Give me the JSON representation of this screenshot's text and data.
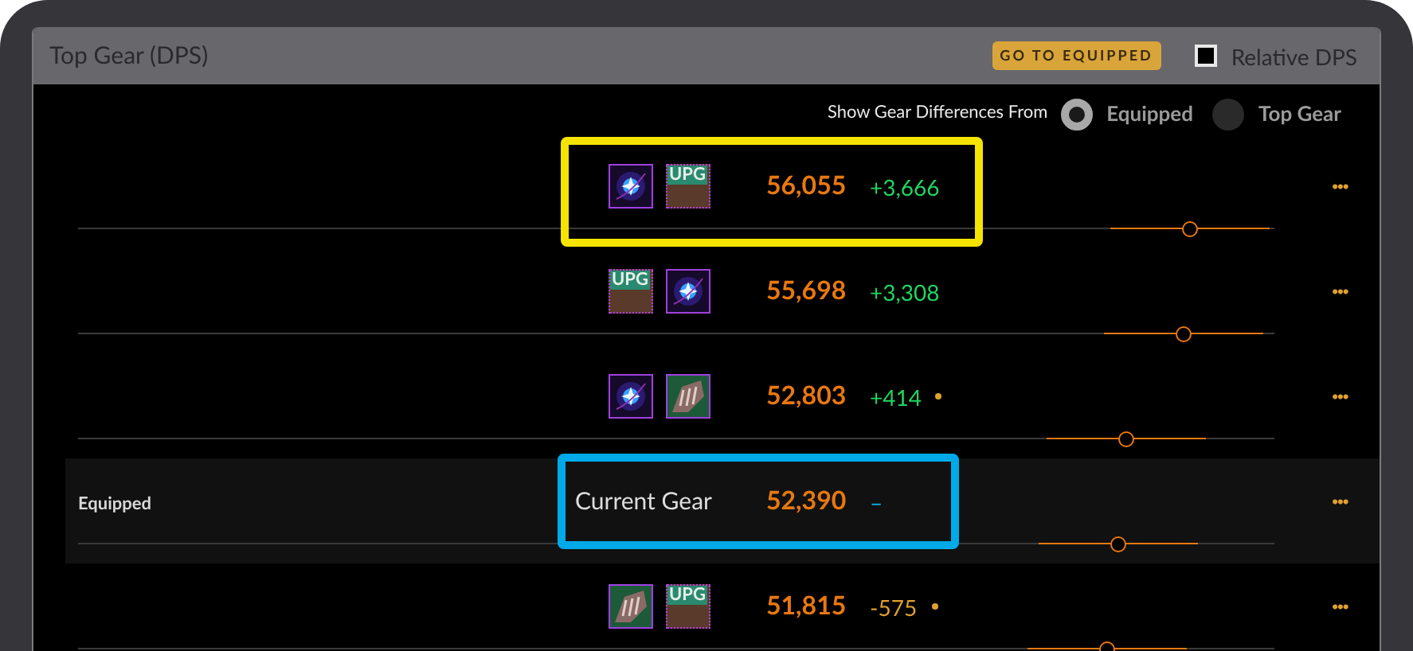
{
  "header": {
    "title": "Top Gear (DPS)",
    "button": "GO TO EQUIPPED",
    "relative": {
      "label": "Relative DPS",
      "checked": false
    }
  },
  "compare": {
    "label": "Show Gear Differences From",
    "options": [
      {
        "label": "Equipped",
        "selected": true
      },
      {
        "label": "Top Gear",
        "selected": false
      }
    ]
  },
  "rows": [
    {
      "kind": "set",
      "items": [
        {
          "kind": "gem"
        },
        {
          "kind": "upg",
          "badge": "UPG"
        }
      ],
      "score": "56,055",
      "diff": {
        "text": "+3,666",
        "color": "#1ed760"
      },
      "dot": false,
      "level": 0.93,
      "menu": "···",
      "highlight": {
        "color": "#f5e400"
      }
    },
    {
      "kind": "set",
      "items": [
        {
          "kind": "upg",
          "badge": "UPG"
        },
        {
          "kind": "gem"
        }
      ],
      "score": "55,698",
      "diff": {
        "text": "+3,308",
        "color": "#1ed760"
      },
      "dot": false,
      "level": 0.924,
      "menu": "···"
    },
    {
      "kind": "set",
      "items": [
        {
          "kind": "gem"
        },
        {
          "kind": "claw"
        }
      ],
      "score": "52,803",
      "diff": {
        "text": "+414",
        "color": "#1ed760"
      },
      "dot": true,
      "level": 0.876,
      "menu": "···"
    },
    {
      "kind": "current",
      "label": "Equipped",
      "name": "Current Gear",
      "score": "52,390",
      "diff": {
        "text": "–",
        "color": "#00b4e6"
      },
      "dot": false,
      "level": 0.87,
      "menu": "···",
      "highlight": {
        "color": "#00aae8"
      }
    },
    {
      "kind": "set",
      "items": [
        {
          "kind": "claw"
        },
        {
          "kind": "upg",
          "badge": "UPG"
        }
      ],
      "score": "51,815",
      "diff": {
        "text": "-575",
        "color": "#e0a030"
      },
      "dot": true,
      "level": 0.86,
      "menu": "···"
    }
  ]
}
